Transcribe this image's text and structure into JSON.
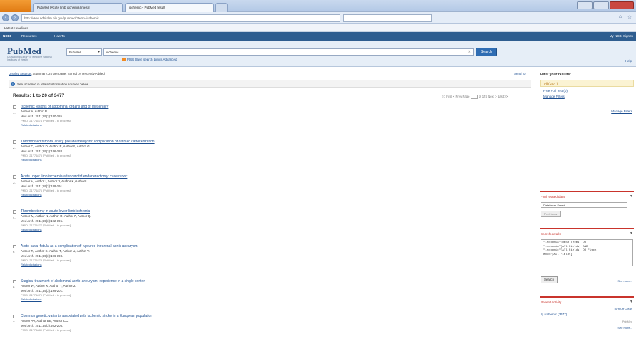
{
  "browser": {
    "tabs": [
      {
        "label": "PubMed (Acute limb ischemia)[mesh]"
      },
      {
        "label": "ischemic - PubMed result"
      }
    ],
    "url": "http://www.ncbi.nlm.nih.gov/pubmed/?term=ischemic",
    "bookmarks": "Latest Headlines"
  },
  "ncbi": {
    "logo": "NCBI",
    "resources": "Resources",
    "howto": "How To",
    "signin": "My NCBI  Sign In"
  },
  "search": {
    "logo": "PubMed",
    "subtitle": "US National Library of Medicine National Institutes of Health",
    "database": "PubMed",
    "query": "ischemic",
    "button": "Search",
    "rss": "RSS  Save search  Limits  Advanced",
    "help": "Help"
  },
  "breadcrumb": {
    "display": "Display Settings",
    "rest": ": Summary, 20 per page, Sorted by Recently Added"
  },
  "send_to": "Send to",
  "info": "See ischemic in related information sources below.",
  "results_header": "Results: 1 to 20 of 3477",
  "pager": {
    "first": "<< First",
    "prev": "< Prev",
    "page_label": "Page",
    "page": "1",
    "of": "of 174",
    "next": "Next >",
    "last": "Last >>"
  },
  "results": [
    {
      "num": "1.",
      "title": "Ischemic lesions of abdominal organs and of mesentery",
      "authors": "Author A, Author B.",
      "journal": "Med Arch. 2011;65(3):180-185.",
      "pmid": "PMID: 21776874 [PubMed - in process]",
      "related": "Related citations"
    },
    {
      "num": "2.",
      "title": "Thrombosed femoral artery pseudoaneurysm: complication of cardiac catheterization",
      "authors": "Author C, Author D, Author E, Author F, Author G.",
      "journal": "Med Arch. 2011;65(3):186-188.",
      "pmid": "PMID: 21776875 [PubMed - in process]",
      "related": "Related citations"
    },
    {
      "num": "3.",
      "title": "Acute upper limb ischemia after carotid endarterectomy: case report",
      "authors": "Author H, Author I, Author J, Author K, Author L.",
      "journal": "Med Arch. 2011;65(3):189-191.",
      "pmid": "PMID: 21776876 [PubMed - in process]",
      "related": "Related citations"
    },
    {
      "num": "4.",
      "title": "Thrombectomy in acute lower limb ischemia",
      "authors": "Author M, Author N, Author O, Author P, Author Q.",
      "journal": "Med Arch. 2011;65(3):192-195.",
      "pmid": "PMID: 21776877 [PubMed - in process]",
      "related": "Related citations"
    },
    {
      "num": "5.",
      "title": "Aorto-caval fistula as a complication of ruptured infrarenal aortic aneurysm",
      "authors": "Author R, Author S, Author T, Author U, Author V.",
      "journal": "Med Arch. 2011;65(3):196-198.",
      "pmid": "PMID: 21776878 [PubMed - in process]",
      "related": "Related citations"
    },
    {
      "num": "6.",
      "title": "Surgical treatment of abdominal aortic aneurysm: experience in a single center",
      "authors": "Author W, Author X, Author Y, Author Z.",
      "journal": "Med Arch. 2011;65(3):199-201.",
      "pmid": "PMID: 21776879 [PubMed - in process]",
      "related": "Related citations"
    },
    {
      "num": "7.",
      "title": "Common genetic variants associated with ischemic stroke in a European population",
      "authors": "Author AA, Author BB, Author CC.",
      "journal": "Med Arch. 2011;65(3):202-205.",
      "pmid": "PMID: 21776880 [PubMed - in process]",
      "related": "Related citations"
    }
  ],
  "sidebar": {
    "filter_title": "Filter your results:",
    "filter_all": "All (3477)",
    "filter_free": "Free Full Text (0)",
    "manage_filters": "Manage Filters",
    "manage_filters2": "Manage Filters",
    "find_title": "Find related data",
    "find_db": "Database: Select",
    "find_btn": "Find items",
    "details_title": "Search details",
    "details_query": "\"ischemia\"[MeSH Terms] OR\n\"ischemia\"[All Fields] AND\n\"ischemic\"[All Fields] OR \"isch\nemic\"[All Fields]",
    "details_btn": "Search",
    "details_more": "See more...",
    "activity_title": "Recent activity",
    "activity_turnoff": "Turn Off  Clear",
    "activity_item": "ischemic (3477)",
    "activity_pm": "PubMed",
    "activity_more": "See more..."
  }
}
